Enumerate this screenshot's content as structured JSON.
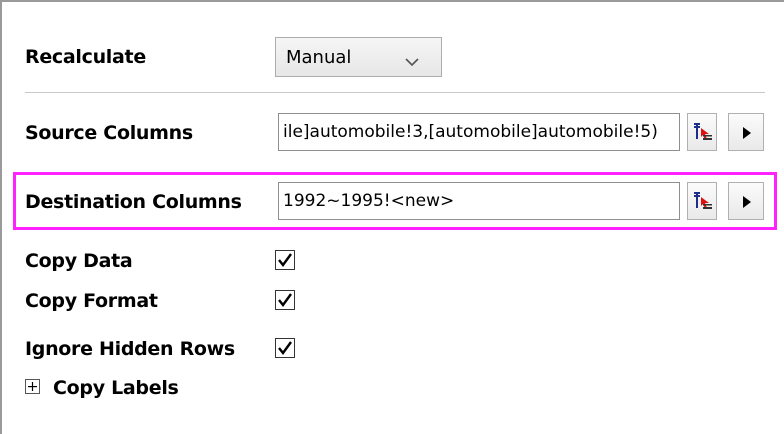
{
  "recalculate": {
    "label": "Recalculate",
    "value": "Manual",
    "options": [
      "Manual"
    ]
  },
  "source_columns": {
    "label": "Source Columns",
    "value": "ile]automobile!3,[automobile]automobile!5)"
  },
  "destination_columns": {
    "label": "Destination Columns",
    "value": "1992~1995!<new>"
  },
  "copy_data": {
    "label": "Copy Data",
    "checked": true
  },
  "copy_format": {
    "label": "Copy Format",
    "checked": true
  },
  "ignore_hidden_rows": {
    "label": "Ignore Hidden Rows",
    "checked": true
  },
  "copy_labels": {
    "label": "Copy Labels",
    "expanded": false
  },
  "colors": {
    "highlight": "#ff22ff",
    "border": "#9a9a9a"
  },
  "icons": {
    "column_select": "select-columns-icon",
    "menu_arrow": "right-arrow-icon",
    "dropdown": "chevron-down-icon",
    "expand": "plus-box-icon",
    "check": "checkmark-icon"
  }
}
